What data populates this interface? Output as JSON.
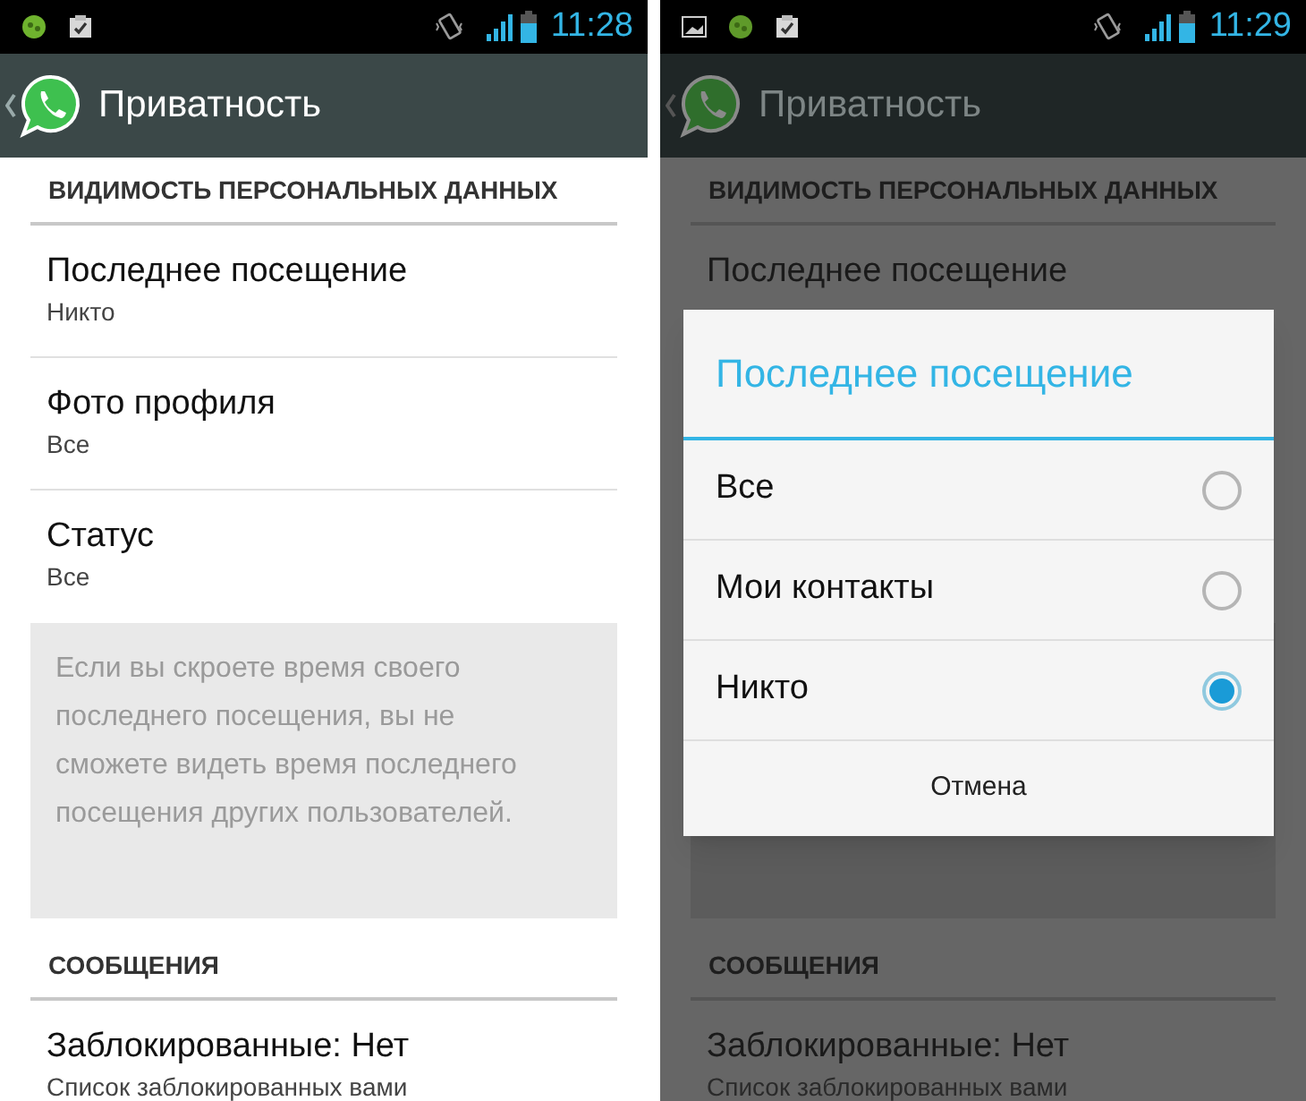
{
  "screens": [
    {
      "dimmed": false,
      "notifications": [
        {
          "kind": "bug"
        },
        {
          "kind": "task"
        }
      ],
      "time": "11:28",
      "title": "Приватность",
      "sections": [
        {
          "heading": "ВИДИМОСТЬ ПЕРСОНАЛЬНЫХ ДАННЫХ",
          "items": [
            {
              "title": "Последнее посещение",
              "subtitle": "Никто"
            },
            {
              "title": "Фото профиля",
              "subtitle": "Все"
            },
            {
              "title": "Статус",
              "subtitle": "Все"
            }
          ],
          "note": {
            "text": "Если вы скроете время своего последнего посещения, вы не сможете видеть время последнего посещения других пользователей."
          }
        },
        {
          "heading": "СООБЩЕНИЯ",
          "items": [
            {
              "title": "Заблокированные: Нет",
              "subtitle": "Список заблокированных вами"
            }
          ]
        }
      ]
    },
    {
      "dimmed": true,
      "notifications": [
        {
          "kind": "image"
        },
        {
          "kind": "bug"
        },
        {
          "kind": "task"
        }
      ],
      "time": "11:29",
      "title": "Приватность",
      "sections": [
        {
          "heading": "ВИДИМОСТЬ ПЕРСОНАЛЬНЫХ ДАННЫХ",
          "items": [
            {
              "title": "Последнее посещение"
            }
          ],
          "note": {
            "kind": "panel"
          }
        },
        {
          "heading": "СООБЩЕНИЯ",
          "items": [
            {
              "title": "Заблокированные: Нет",
              "subtitle": "Список заблокированных вами"
            }
          ]
        }
      ],
      "dialog": {
        "title": "Последнее посещение",
        "options": [
          {
            "label": "Все",
            "selected": false
          },
          {
            "label": "Мои контакты",
            "selected": false
          },
          {
            "label": "Никто",
            "selected": true
          }
        ],
        "cancel": "Отмена"
      }
    }
  ]
}
